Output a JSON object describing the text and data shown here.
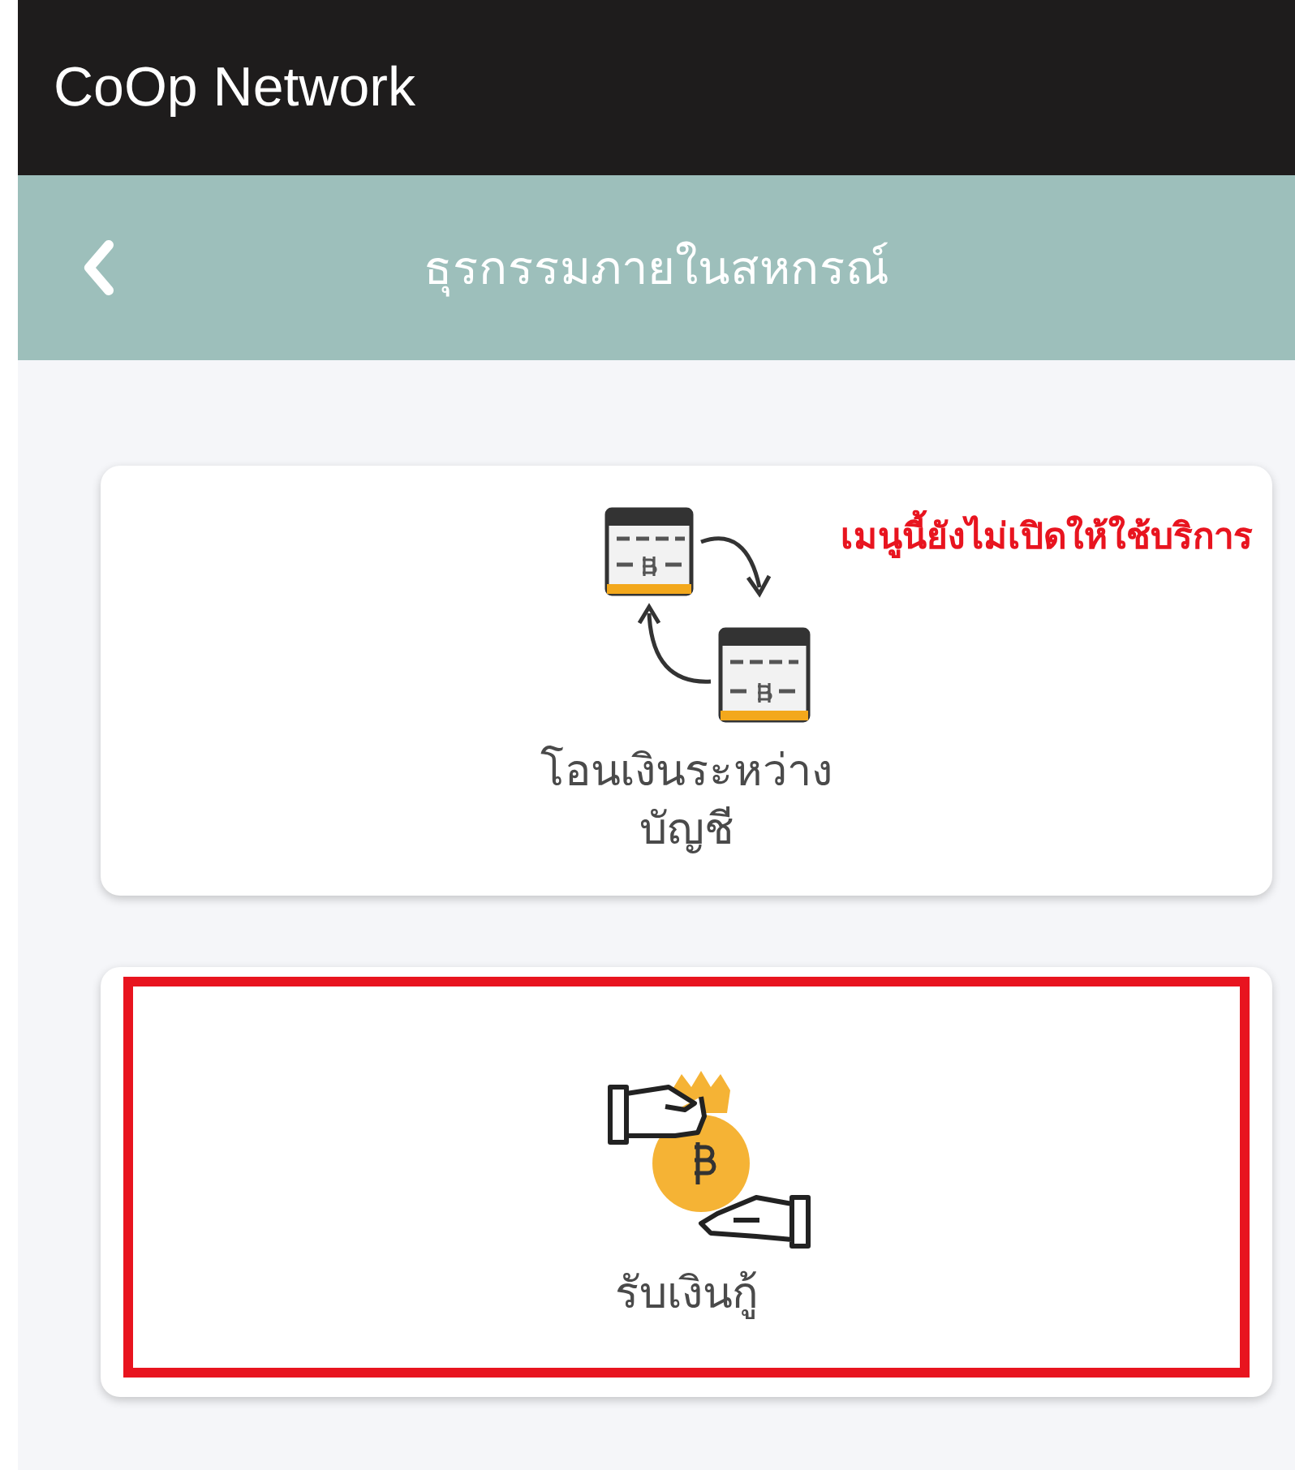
{
  "app_bar": {
    "title": "CoOp Network"
  },
  "header": {
    "title": "ธุรกรรมภายในสหกรณ์"
  },
  "menu_items": [
    {
      "kind": "transfer",
      "label_lines": [
        "โอนเงินระหว่าง",
        "บัญชี"
      ],
      "note": "เมนูนี้ยังไม่เปิดให้ใช้บริการ",
      "highlighted": false
    },
    {
      "kind": "loan",
      "label_lines": [
        "รับเงินกู้"
      ],
      "highlighted": true
    }
  ]
}
